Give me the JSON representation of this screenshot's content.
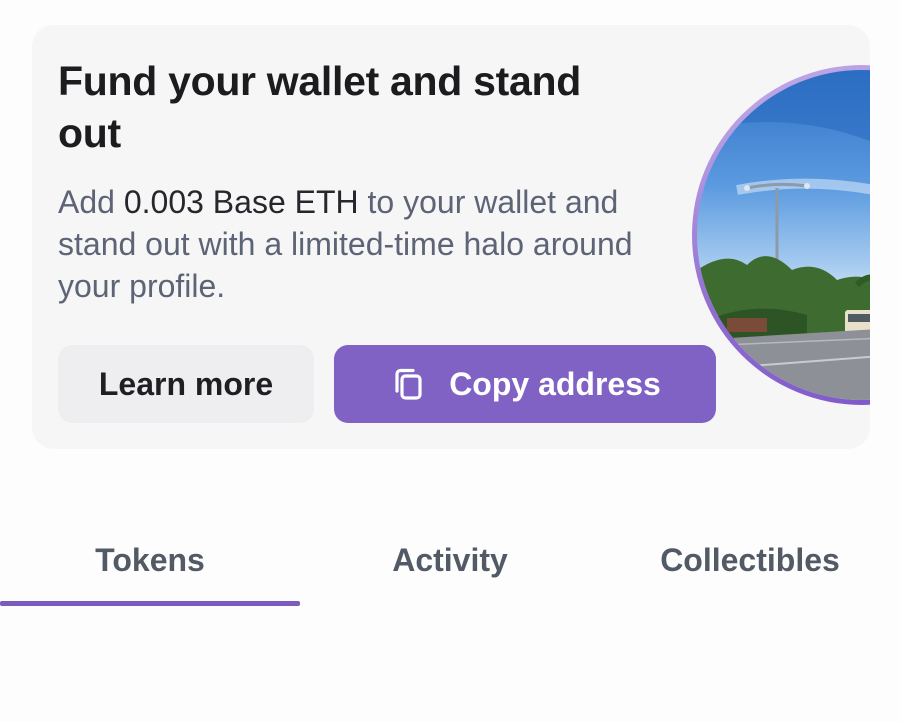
{
  "promo": {
    "title": "Fund your wallet and stand out",
    "description": {
      "prefix": "Add ",
      "amount": "0.003 Base ETH",
      "suffix": " to your wallet and stand out with a limited-time halo around your profile."
    },
    "learn_more_label": "Learn more",
    "copy_address_label": "Copy address",
    "copy_icon": "copy-icon",
    "accent_color": "#7f62c4"
  },
  "tabs": {
    "items": [
      {
        "label": "Tokens",
        "active": true
      },
      {
        "label": "Activity",
        "active": false
      },
      {
        "label": "Collectibles",
        "active": false
      }
    ],
    "active_color": "#7c5bbf"
  }
}
